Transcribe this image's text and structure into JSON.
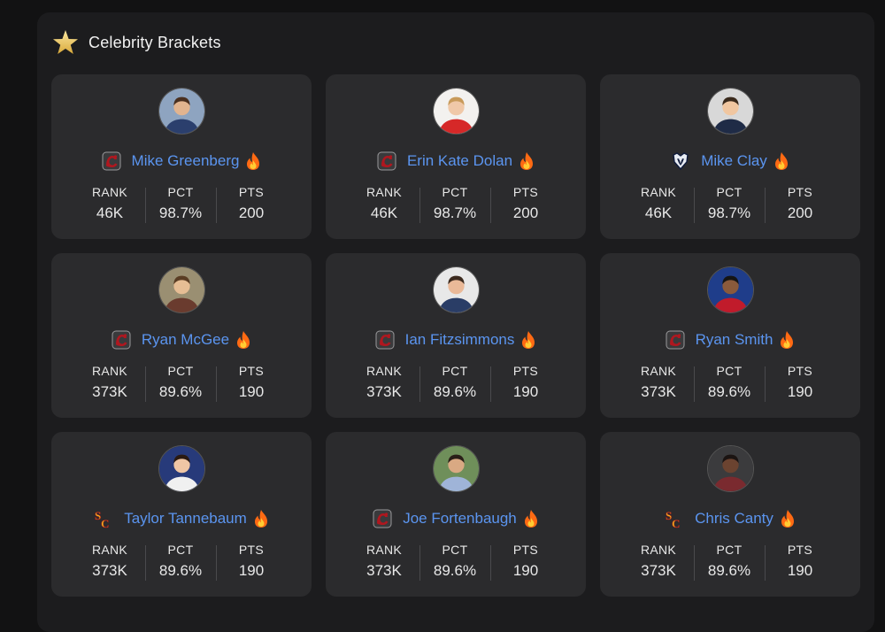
{
  "section": {
    "title": "Celebrity Brackets",
    "icon": "star-icon",
    "star_color": "#e9c44d"
  },
  "stat_labels": {
    "rank": "RANK",
    "pct": "PCT",
    "pts": "PTS"
  },
  "colors": {
    "name_link": "#5b95f0",
    "card_bg": "#2b2b2d",
    "panel_bg": "#1c1c1e"
  },
  "cards": [
    {
      "name": "Mike Greenberg",
      "team_logo": "south-carolina-logo",
      "rank": "46K",
      "pct": "98.7%",
      "pts": "200",
      "badge": "fire-icon"
    },
    {
      "name": "Erin Kate Dolan",
      "team_logo": "south-carolina-logo",
      "rank": "46K",
      "pct": "98.7%",
      "pts": "200",
      "badge": "fire-icon"
    },
    {
      "name": "Mike Clay",
      "team_logo": "uconn-logo",
      "rank": "46K",
      "pct": "98.7%",
      "pts": "200",
      "badge": "fire-icon"
    },
    {
      "name": "Ryan McGee",
      "team_logo": "south-carolina-logo",
      "rank": "373K",
      "pct": "89.6%",
      "pts": "190",
      "badge": "fire-icon"
    },
    {
      "name": "Ian Fitzsimmons",
      "team_logo": "south-carolina-logo",
      "rank": "373K",
      "pct": "89.6%",
      "pts": "190",
      "badge": "fire-icon"
    },
    {
      "name": "Ryan Smith",
      "team_logo": "south-carolina-logo",
      "rank": "373K",
      "pct": "89.6%",
      "pts": "190",
      "badge": "fire-icon"
    },
    {
      "name": "Taylor Tannebaum",
      "team_logo": "usc-logo",
      "rank": "373K",
      "pct": "89.6%",
      "pts": "190",
      "badge": "fire-icon"
    },
    {
      "name": "Joe Fortenbaugh",
      "team_logo": "south-carolina-logo",
      "rank": "373K",
      "pct": "89.6%",
      "pts": "190",
      "badge": "fire-icon"
    },
    {
      "name": "Chris Canty",
      "team_logo": "usc-logo",
      "rank": "373K",
      "pct": "89.6%",
      "pts": "190",
      "badge": "fire-icon"
    }
  ]
}
